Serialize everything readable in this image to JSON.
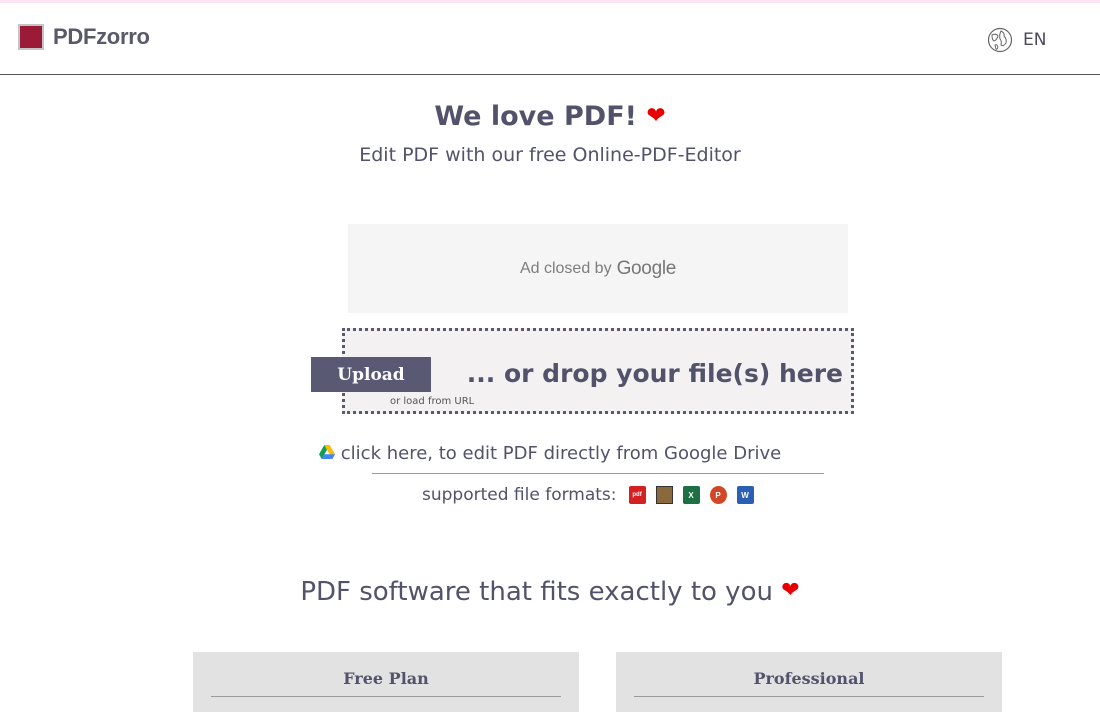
{
  "header": {
    "logo_text": "PDFzorro",
    "lang_label": "EN"
  },
  "hero": {
    "title": "We love PDF!",
    "heart": "❤",
    "subtitle": "Edit PDF with our free Online-PDF-Editor"
  },
  "ad": {
    "text": "Ad closed by",
    "brand": "Google"
  },
  "upload": {
    "button_label": "Upload",
    "drop_text": "... or drop your file(s) here",
    "load_url_label": "or load from URL"
  },
  "gdrive": {
    "label": "click here, to edit PDF directly from Google Drive"
  },
  "formats": {
    "label": "supported file formats:",
    "icons": [
      "pdf-icon",
      "image-icon",
      "excel-icon",
      "powerpoint-icon",
      "word-icon"
    ],
    "pdf_text": "pdf",
    "xls_text": "X",
    "ppt_text": "P",
    "doc_text": "W"
  },
  "section": {
    "title": "PDF software that fits exactly to you",
    "heart": "❤"
  },
  "plans": [
    {
      "name": "Free Plan"
    },
    {
      "name": "Professional"
    }
  ],
  "colors": {
    "brand": "#9b1a38",
    "button": "#595973",
    "text": "#52526a",
    "heart": "#e60000"
  }
}
